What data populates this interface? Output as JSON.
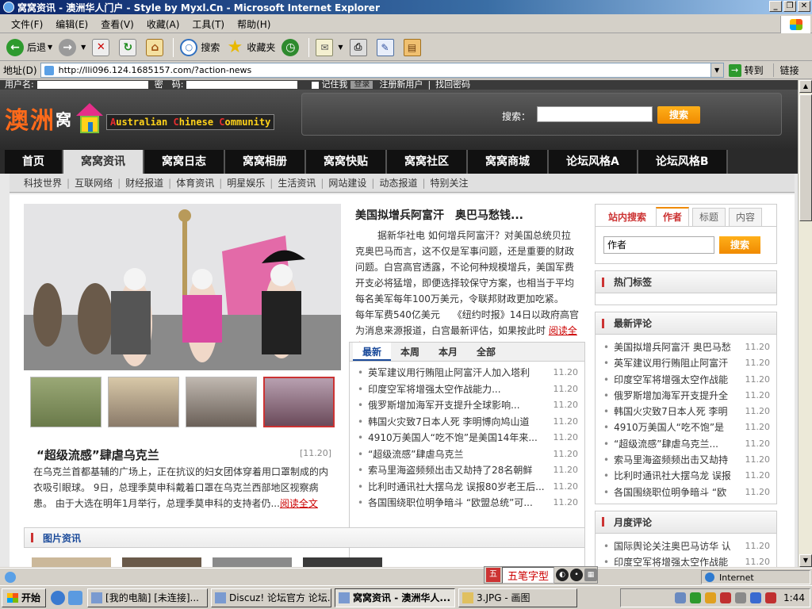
{
  "window": {
    "title": "窝窝资讯 - 澳洲华人门户 - Style by Myxl.Cn - Microsoft Internet Explorer",
    "controls": [
      "_",
      "❐",
      "✕"
    ]
  },
  "menu": [
    "文件(F)",
    "编辑(E)",
    "查看(V)",
    "收藏(A)",
    "工具(T)",
    "帮助(H)"
  ],
  "toolbar": {
    "back": "后退",
    "search": "搜索",
    "favorites": "收藏夹"
  },
  "address": {
    "label": "地址(D)",
    "url": "http://lli096.124.1685157.com/?action-news",
    "go": "转到",
    "links": "链接"
  },
  "site": {
    "login": {
      "user_label": "用户名:",
      "pass_label": "密　码:",
      "remember": "记住我",
      "login_btn": "登录",
      "register": "注册新用户",
      "forgot": "找回密码"
    },
    "logo_cn": "澳洲",
    "logo_mid": "窝",
    "logo_en_parts": [
      "A",
      "ustralian ",
      "C",
      "hinese ",
      "C",
      "ommunity"
    ],
    "search_label": "搜索：",
    "search_btn": "搜索",
    "nav": [
      "首页",
      "窝窝资讯",
      "窝窝日志",
      "窝窝相册",
      "窝窝快贴",
      "窝窝社区",
      "窝窝商城",
      "论坛风格A",
      "论坛风格B"
    ],
    "nav_active": 1,
    "subnav": [
      "科技世界",
      "互联网络",
      "财经报道",
      "体育资讯",
      "明星娱乐",
      "生活资讯",
      "网站建设",
      "动态报道",
      "特别关注"
    ]
  },
  "feature": {
    "title": "“超级流感”肆虐乌克兰",
    "date": "[11.20]",
    "text": "在乌克兰首都基辅的广场上，正在抗议的妇女团体穿着用口罩制成的内衣吸引眼球。 9日，总理季莫申科戴着口罩在乌克兰西部地区视察病患。 由于大选在明年1月举行，总理季莫申科的支持者仍...",
    "readmore": "阅读全文"
  },
  "article": {
    "title": "美国拟增兵阿富汗　奥巴马愁钱...",
    "text": "据新华社电 如何增兵阿富汗？对美国总统贝拉克奥巴马而言，这不仅是军事问题，还是重要的财政问题。白宫高官透露，不论何种规模增兵，美国军费开支必将猛增，即便选择较保守方案，也相当于平均每名美军每年100万美元，令联邦财政更加吃紧。　 每年军费540亿美元　 《纽约时报》14日以政府高官为消息来源报道，白宫最新评估，如果按此时",
    "readmore": "阅读全文"
  },
  "tabs": [
    "最新",
    "本周",
    "本月",
    "全部"
  ],
  "news": [
    {
      "title": "英军建议用行贿阻止阿富汗人加入塔利",
      "date": "11.20"
    },
    {
      "title": "印度空军将增强太空作战能力...",
      "date": "11.20"
    },
    {
      "title": "俄罗斯增加海军开支提升全球影响...",
      "date": "11.20"
    },
    {
      "title": "韩国火灾致7日本人死 李明博向鸠山道",
      "date": "11.20"
    },
    {
      "title": "4910万美国人“吃不饱”是美国14年来...",
      "date": "11.20"
    },
    {
      "title": "“超级流感”肆虐乌克兰",
      "date": "11.20"
    },
    {
      "title": "索马里海盗频频出击又劫持了28名朝鲜",
      "date": "11.20"
    },
    {
      "title": "比利时通讯社大摆乌龙 误报80岁老王后...",
      "date": "11.20"
    },
    {
      "title": "各国围绕职位明争暗斗 “欧盟总统”可...",
      "date": "11.20"
    }
  ],
  "sidebar": {
    "search_tabs": [
      "站内搜索",
      "作者",
      "标题",
      "内容"
    ],
    "search_value": "作者",
    "search_btn": "搜索",
    "hot_tags": "热门标签",
    "latest_comments": "最新评论",
    "comments": [
      {
        "title": "美国拟增兵阿富汗 奥巴马愁",
        "date": "11.20"
      },
      {
        "title": "英军建议用行贿阻止阿富汗",
        "date": "11.20"
      },
      {
        "title": "印度空军将增强太空作战能",
        "date": "11.20"
      },
      {
        "title": "俄罗斯增加海军开支提升全",
        "date": "11.20"
      },
      {
        "title": "韩国火灾致7日本人死 李明",
        "date": "11.20"
      },
      {
        "title": "4910万美国人“吃不饱”是",
        "date": "11.20"
      },
      {
        "title": "“超级流感”肆虐乌克兰...",
        "date": "11.20"
      },
      {
        "title": "索马里海盗频频出击又劫持",
        "date": "11.20"
      },
      {
        "title": "比利时通讯社大摆乌龙 误报",
        "date": "11.20"
      },
      {
        "title": "各国围绕职位明争暗斗 “欧",
        "date": "11.20"
      }
    ],
    "monthly_comments": "月度评论",
    "monthly": [
      {
        "title": "国际舆论关注奥巴马访华 认",
        "date": "11.20"
      },
      {
        "title": "印度空军将增强太空作战能",
        "date": "11.20"
      }
    ]
  },
  "picnews": "图片资讯",
  "status": {
    "ime": "五笔字型",
    "zone": "Internet"
  },
  "taskbar": {
    "start": "开始",
    "tasks": [
      {
        "label": "[我的电脑] [未连接]...",
        "active": false
      },
      {
        "label": "Discuz! 论坛官方 论坛...",
        "active": false
      },
      {
        "label": "窝窝资讯 - 澳洲华人...",
        "active": true
      },
      {
        "label": "3.JPG - 画图",
        "active": false
      }
    ],
    "clock": "1:44"
  },
  "colors": {
    "accent_orange": "#f08a00",
    "nav_dark": "#111111",
    "link_red": "#cc0000",
    "logo_orange": "#ff6a1a"
  }
}
